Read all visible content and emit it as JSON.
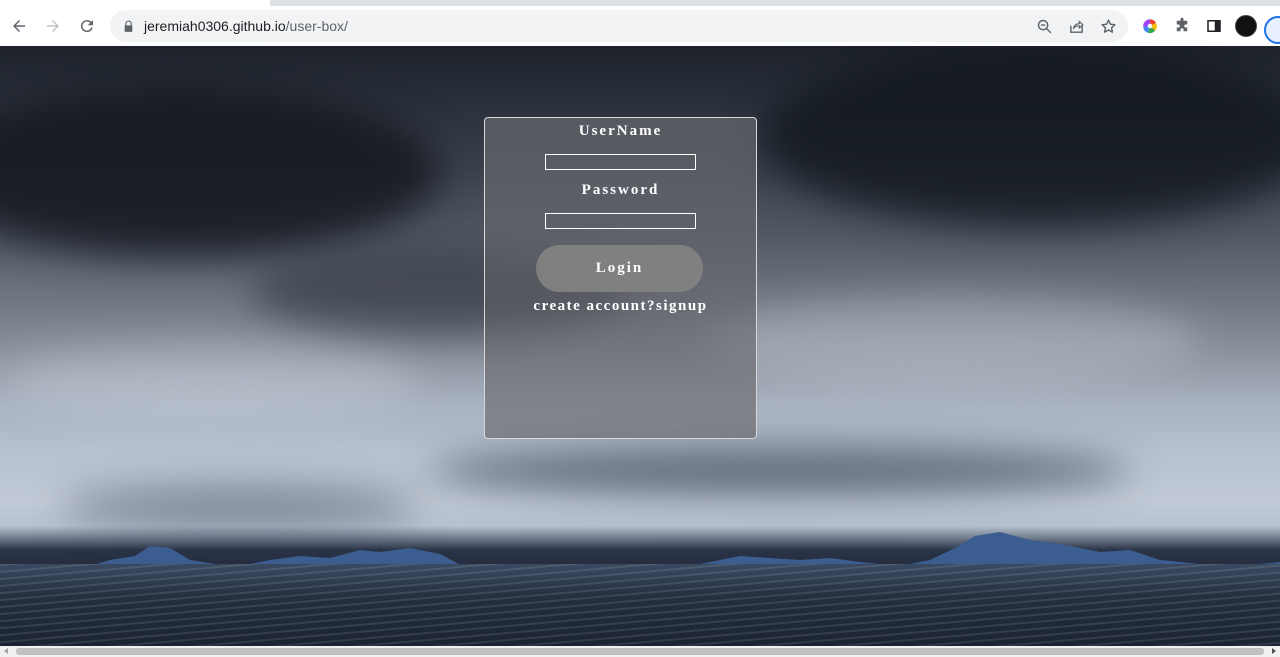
{
  "browser": {
    "url_host": "jeremiah0306.github.io",
    "url_path": "/user-box/"
  },
  "form": {
    "username_label": "UserName",
    "username_value": "",
    "password_label": "Password",
    "password_value": "",
    "login_button": "Login",
    "signup_link": "create account?signup"
  }
}
